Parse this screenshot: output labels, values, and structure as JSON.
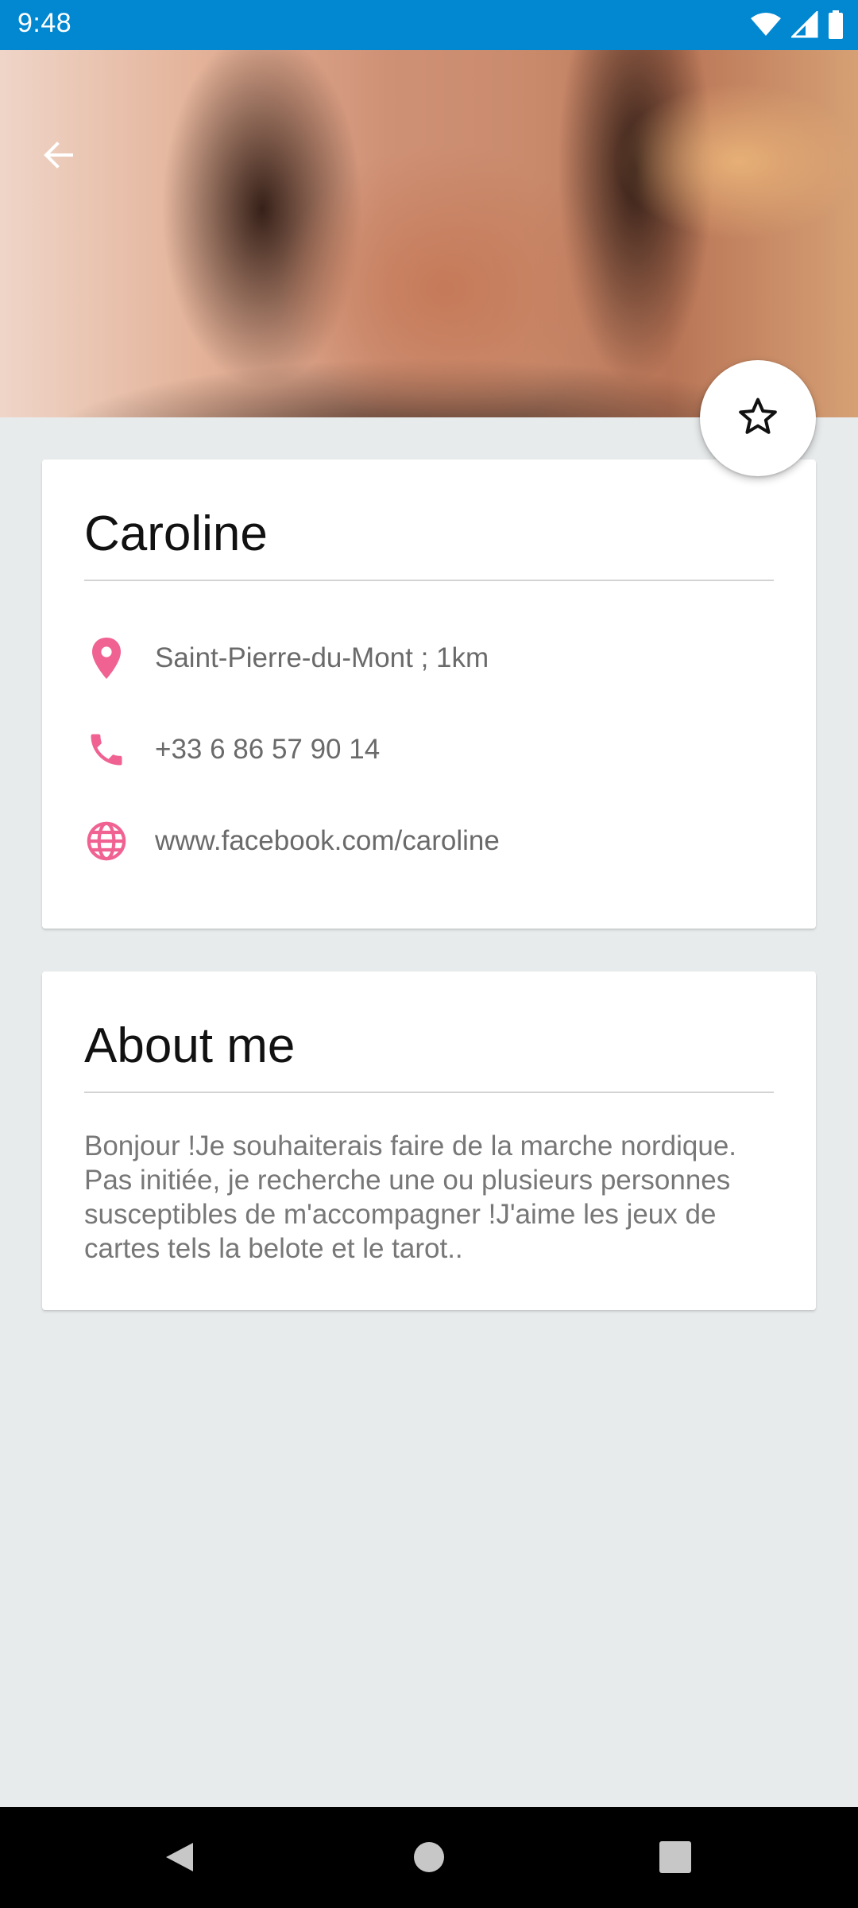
{
  "status_bar": {
    "time": "9:48",
    "icons": [
      "wifi-icon",
      "signal-icon",
      "battery-icon"
    ]
  },
  "header": {
    "back_icon": "arrow-back-icon",
    "photo": "profile-photo"
  },
  "favorite": {
    "icon": "star-outline-icon"
  },
  "contact": {
    "name": "Caroline",
    "rows": [
      {
        "icon": "location-pin-icon",
        "text": "Saint-Pierre-du-Mont ; 1km"
      },
      {
        "icon": "phone-icon",
        "text": "+33 6 86 57 90 14"
      },
      {
        "icon": "globe-icon",
        "text": "www.facebook.com/caroline"
      }
    ]
  },
  "about": {
    "title": "About me",
    "body": "Bonjour !Je souhaiterais faire de la marche nordique. Pas initiée, je recherche une ou plusieurs personnes susceptibles de m'accompagner !J'aime les jeux de cartes tels la belote et le tarot.."
  },
  "nav_bar": {
    "buttons": [
      "back-triangle-icon",
      "home-circle-icon",
      "recents-square-icon"
    ]
  },
  "colors": {
    "status_bar": "#0288d1",
    "accent_icon": "#f06292",
    "background": "#e8ebec"
  }
}
